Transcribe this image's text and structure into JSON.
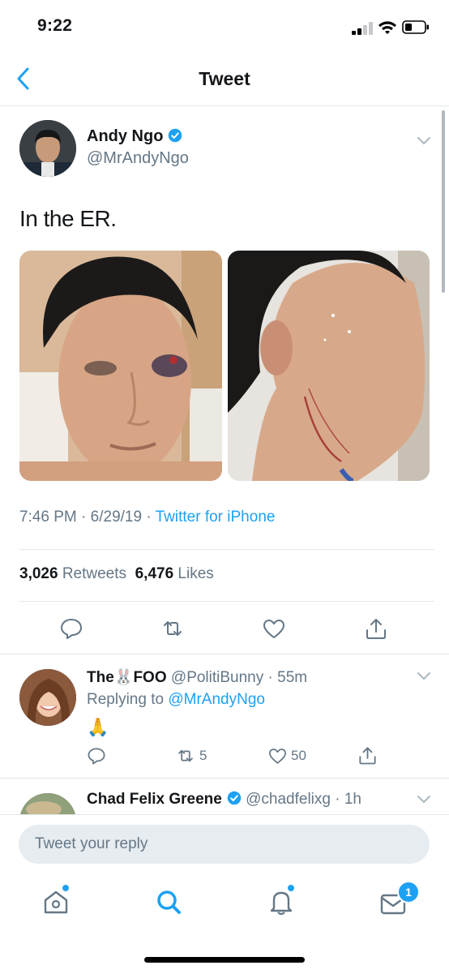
{
  "status_bar": {
    "time": "9:22"
  },
  "nav": {
    "title": "Tweet"
  },
  "tweet": {
    "author_name": "Andy Ngo",
    "author_handle": "@MrAndyNgo",
    "text": "In the ER.",
    "time": "7:46 PM",
    "date": "6/29/19",
    "source": "Twitter for iPhone",
    "retweets_count": "3,026",
    "retweets_label": "Retweets",
    "likes_count": "6,476",
    "likes_label": "Likes"
  },
  "replies": [
    {
      "name": "The",
      "name_suffix": "FOO",
      "emoji": "🐰",
      "handle": "@PolitiBunny",
      "age": "55m",
      "replying_label": "Replying to",
      "replying_to": "@MrAndyNgo",
      "body_emoji": "🙏",
      "retweets": "5",
      "likes": "50"
    },
    {
      "name": "Chad Felix Greene",
      "handle": "@chadfelixg",
      "age": "1h"
    }
  ],
  "composer": {
    "placeholder": "Tweet your reply"
  },
  "tabbar": {
    "messages_badge": "1"
  },
  "colors": {
    "accent": "#1da1f2",
    "secondary_text": "#657786",
    "divider": "#e1e8ed"
  },
  "icons": [
    "back-chevron-icon",
    "verified-icon",
    "chevron-down-icon",
    "reply-icon",
    "retweet-icon",
    "like-icon",
    "share-icon",
    "home-icon",
    "search-icon",
    "notifications-icon",
    "messages-icon"
  ]
}
